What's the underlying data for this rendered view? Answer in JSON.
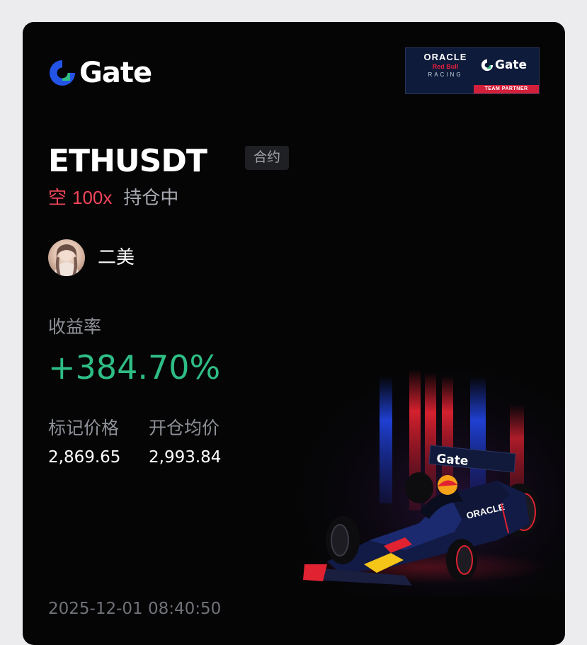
{
  "brand": {
    "name": "Gate",
    "accent": "#2354e6"
  },
  "partner_badge": {
    "oracle": "ORACLE",
    "red_bull": "Red Bull",
    "racing": "RACING",
    "gate": "Gate",
    "strip": "TEAM PARTNER"
  },
  "position": {
    "symbol": "ETHUSDT",
    "type_tag": "合约",
    "side": "空",
    "leverage": "100x",
    "status": "持仓中"
  },
  "user": {
    "name": "二美"
  },
  "pnl": {
    "roi_label": "收益率",
    "roi_value": "+384.70%",
    "mark_price_label": "标记价格",
    "mark_price": "2,869.65",
    "entry_price_label": "开仓均价",
    "entry_price": "2,993.84"
  },
  "timestamp": "2025-12-01 08:40:50",
  "colors": {
    "background": "#050506",
    "short": "#f0455a",
    "profit": "#2ebd85",
    "muted": "#8e9197"
  },
  "icons": {
    "logo": "gate-logo-icon",
    "avatar": "user-avatar",
    "car": "f1-car-image"
  }
}
